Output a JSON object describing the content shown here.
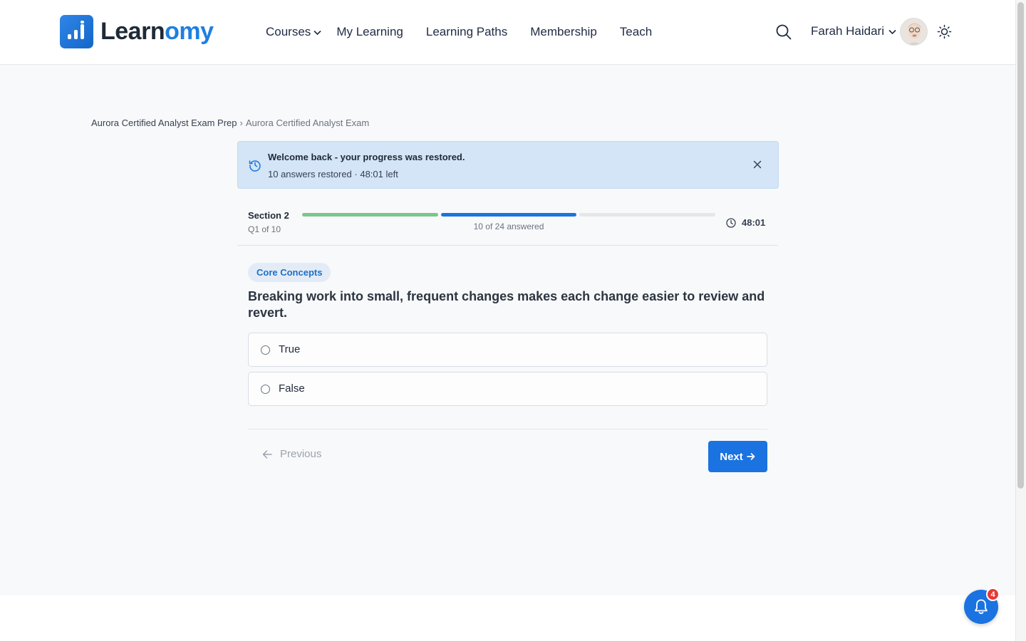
{
  "header": {
    "logo": {
      "text_main": "Learn",
      "text_accent": "omy"
    },
    "nav": [
      {
        "label": "Courses",
        "has_dropdown": true
      },
      {
        "label": "My Learning"
      },
      {
        "label": "Learning Paths"
      },
      {
        "label": "Membership"
      },
      {
        "label": "Teach"
      }
    ],
    "user": {
      "name": "Farah Haidari"
    },
    "icons": {
      "search": "search-icon",
      "theme": "sun-icon",
      "user_caret": "chevron-down-icon"
    }
  },
  "breadcrumb": {
    "parent": "Aurora Certified Analyst Exam Prep",
    "separator": "›",
    "current": "Aurora Certified Analyst Exam"
  },
  "alert": {
    "title": "Welcome back - your progress was restored.",
    "subtitle": "10 answers restored · 48:01 left",
    "icon": "history-icon",
    "close_icon": "close-icon"
  },
  "progress": {
    "section": "Section 2",
    "question_position": "Q1 of 10",
    "answered_text": "10 of 24 answered",
    "segments": [
      {
        "status": "complete",
        "color": "#7cc68a"
      },
      {
        "status": "current",
        "color": "#1a73e0"
      },
      {
        "status": "pending",
        "color": "#e5e7eb"
      }
    ],
    "timer": "48:01"
  },
  "question": {
    "tag": "Core Concepts",
    "text": "Breaking work into small, frequent changes makes each change easier to review and revert.",
    "options": [
      {
        "label": "True",
        "selected": false
      },
      {
        "label": "False",
        "selected": false
      }
    ]
  },
  "navigation": {
    "previous_label": "Previous",
    "next_label": "Next"
  },
  "notifications": {
    "count": "4",
    "icon": "bell-icon"
  },
  "colors": {
    "primary": "#1a73e0",
    "alert_bg": "#d3e5f6",
    "tag_bg": "#e3ecf6"
  }
}
